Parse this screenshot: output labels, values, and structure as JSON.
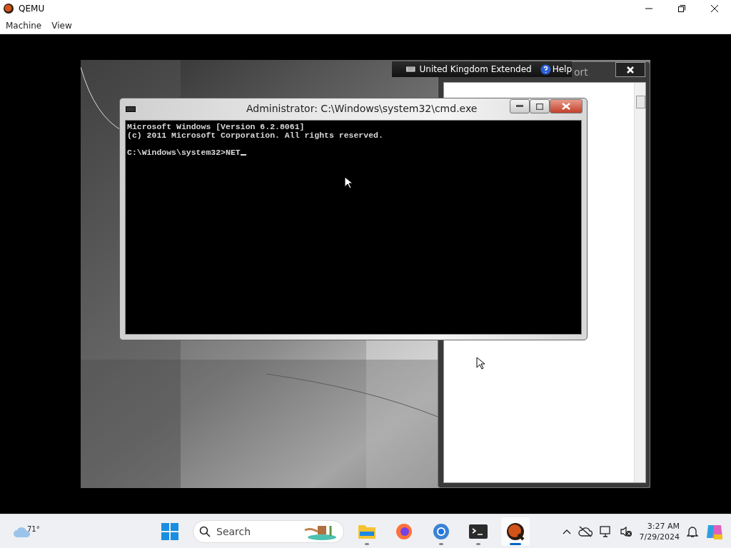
{
  "window": {
    "title": "QEMU"
  },
  "menu": [
    {
      "label": "Machine"
    },
    {
      "label": "View"
    }
  ],
  "guest": {
    "language_bar": {
      "layout": "United Kingdom Extended",
      "help": "Help"
    },
    "background_window": {
      "title_fragment": "ort"
    },
    "console": {
      "title": "Administrator: C:\\Windows\\system32\\cmd.exe",
      "output": [
        "Microsoft Windows [Version 6.2.8061]",
        "(c) 2011 Microsoft Corporation. All rights reserved."
      ],
      "prompt": "C:\\Windows\\system32>NET"
    }
  },
  "taskbar": {
    "weather": {
      "temperature": "71°"
    },
    "search": {
      "placeholder": "Search"
    },
    "apps": [
      {
        "kind": "files",
        "running": true,
        "selected": false
      },
      {
        "kind": "firefox",
        "running": false,
        "selected": false
      },
      {
        "kind": "chrome",
        "running": true,
        "selected": false
      },
      {
        "kind": "terminal",
        "running": true,
        "selected": false
      },
      {
        "kind": "qemu",
        "running": true,
        "selected": true
      }
    ],
    "clock": {
      "time": "3:27 AM",
      "date": "7/29/2024"
    }
  }
}
